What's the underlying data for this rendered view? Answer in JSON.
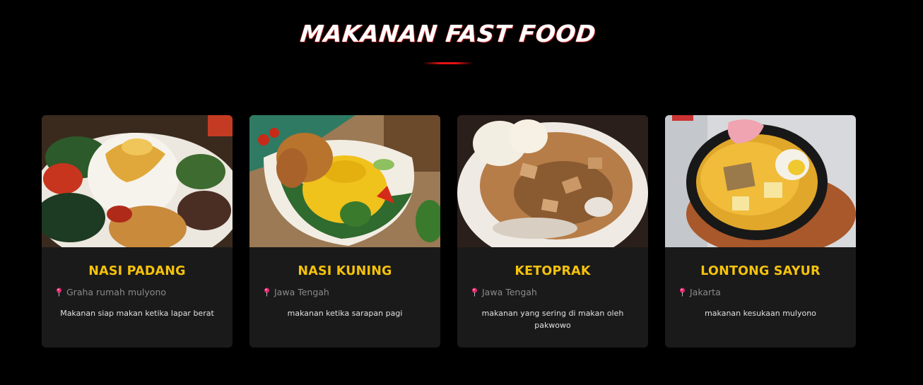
{
  "section": {
    "title": "MAKANAN FAST FOOD"
  },
  "colors": {
    "background": "#000000",
    "card_bg": "#1a1a1a",
    "title_yellow": "#f5c20c",
    "accent_red": "#e41313",
    "location_gray": "#8a8a8a"
  },
  "cards": [
    {
      "title": "NASI PADANG",
      "location": "Graha rumah mulyono",
      "description": "Makanan siap makan ketika lapar berat",
      "icon": "map-pin-icon"
    },
    {
      "title": "NASI KUNING",
      "location": "Jawa Tengah",
      "description": "makanan ketika sarapan pagi",
      "icon": "map-pin-icon"
    },
    {
      "title": "KETOPRAK",
      "location": "Jawa Tengah",
      "description": "makanan yang sering di makan oleh pakwowo",
      "icon": "map-pin-icon"
    },
    {
      "title": "LONTONG SAYUR",
      "location": "Jakarta",
      "description": "makanan kesukaan mulyono",
      "icon": "map-pin-icon"
    }
  ]
}
